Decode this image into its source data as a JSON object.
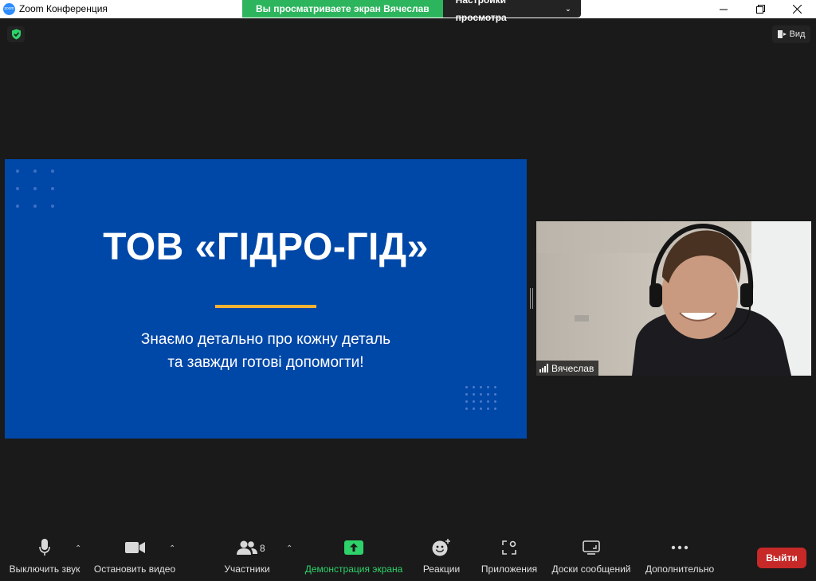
{
  "window": {
    "app_logo_text": "zoom",
    "title": "Zoom Конференция",
    "controls": [
      "minimize-icon",
      "restore-icon",
      "close-icon"
    ]
  },
  "share_banner": {
    "message": "Вы просматриваете экран Вячеслав",
    "view_options_label": "Настройки просмотра"
  },
  "top_right": {
    "view_label": "Вид"
  },
  "slide": {
    "title": "ТОВ «ГІДРО-ГІД»",
    "subtitle_line1": "Знаємо детально про кожну деталь",
    "subtitle_line2": "та завжди готові допомогти!",
    "background_color": "#0048a8",
    "accent_color": "#f2b233"
  },
  "video_tile": {
    "participant_name": "Вячеслав"
  },
  "toolbar": {
    "mute_label": "Выключить звук",
    "stop_video_label": "Остановить видео",
    "participants_label": "Участники",
    "participants_count": "8",
    "share_label": "Демонстрация экрана",
    "reactions_label": "Реакции",
    "apps_label": "Приложения",
    "whiteboards_label": "Доски сообщений",
    "more_label": "Дополнительно",
    "leave_label": "Выйти",
    "share_color": "#2ed26a",
    "leave_color": "#c72828"
  }
}
